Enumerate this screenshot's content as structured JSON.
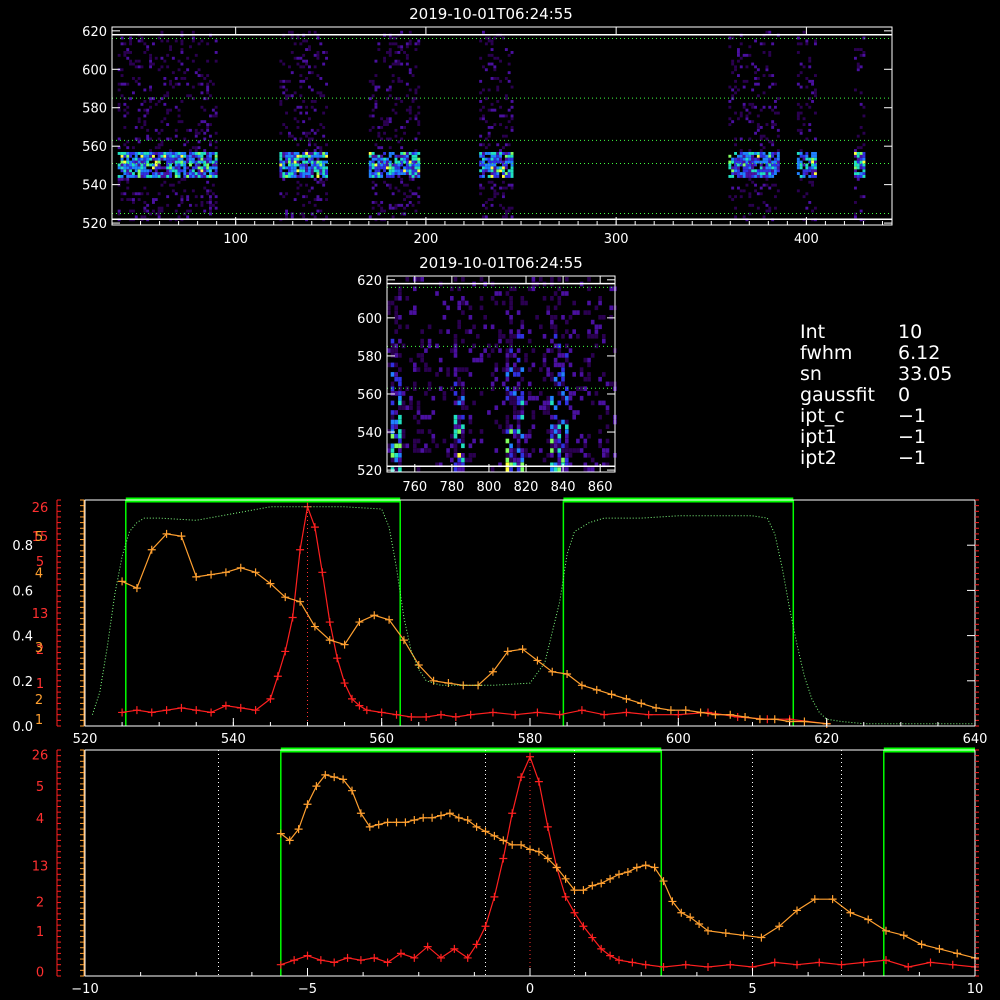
{
  "top_title": "2019-10-01T06:24:55",
  "zoom_title": "2019-10-01T06:24:55",
  "info": [
    {
      "key": "Int",
      "value": "10"
    },
    {
      "key": "fwhm",
      "value": "6.12"
    },
    {
      "key": "sn",
      "value": "33.05"
    },
    {
      "key": "gaussfit",
      "value": "0"
    },
    {
      "key": "ipt_c",
      "value": "−1"
    },
    {
      "key": "ipt1",
      "value": "−1"
    },
    {
      "key": "ipt2",
      "value": "−1"
    }
  ],
  "colors": {
    "background": "#000000",
    "axes": "#ffffff",
    "reference_lines": "#00ff00",
    "cut_line": "#ff3030",
    "profile_red": "#ff2020",
    "profile_orange": "#ffa030",
    "filter_curve": "#80ff80",
    "intensity_high": "#ffff40"
  },
  "chart_data": [
    {
      "type": "heatmap",
      "name": "top-spectrogram",
      "title": "2019-10-01T06:24:55",
      "x_ticks": [
        "100",
        "200",
        "300",
        "400"
      ],
      "y_ticks": [
        "620",
        "600",
        "580",
        "560",
        "540",
        "520"
      ],
      "xlim": [
        35,
        445
      ],
      "ylim": [
        519,
        622
      ],
      "reference_levels": [
        616,
        585,
        563,
        551,
        525
      ],
      "bright_row": 550,
      "bright_row_span": [
        543,
        556
      ],
      "signal_columns": [
        [
          38,
          90
        ],
        [
          123,
          148
        ],
        [
          170,
          196
        ],
        [
          228,
          246
        ],
        [
          359,
          385
        ],
        [
          395,
          405
        ],
        [
          425,
          430
        ]
      ]
    },
    {
      "type": "heatmap",
      "name": "zoom-spectrogram",
      "title": "2019-10-01T06:24:55",
      "x_ticks": [
        "760",
        "780",
        "800",
        "820",
        "840",
        "860"
      ],
      "y_ticks": [
        "620",
        "600",
        "580",
        "560",
        "540",
        "520"
      ],
      "xlim": [
        745,
        868
      ],
      "ylim": [
        519,
        622
      ],
      "reference_levels": [
        616,
        585,
        563
      ],
      "streaks": [
        [
          746,
          752
        ],
        [
          780,
          786
        ],
        [
          808,
          818
        ],
        [
          832,
          842
        ]
      ]
    },
    {
      "type": "line",
      "name": "wavelength-profile",
      "x_ticks": [
        "520",
        "540",
        "560",
        "580",
        "600",
        "620",
        "640"
      ],
      "xlim": [
        520,
        640
      ],
      "ylim": [
        0,
        1
      ],
      "left_ticks_white": [
        "0.0",
        "0.2",
        "0.4",
        "0.6",
        "0.8"
      ],
      "left_ticks_white_values": [
        0.0,
        0.2,
        0.4,
        0.6,
        0.8
      ],
      "left_ticks_red": [
        "26",
        "15",
        "5",
        "13",
        "2",
        "1"
      ],
      "left_ticks_red_values": [
        0.97,
        0.84,
        0.73,
        0.5,
        0.34,
        0.19
      ],
      "left_ticks_orange": [
        "5",
        "4",
        "3",
        "2",
        "1"
      ],
      "left_ticks_orange_values": [
        0.84,
        0.68,
        0.35,
        0.12,
        0.03
      ],
      "green_bands": [
        [
          525.5,
          562.5
        ],
        [
          584.5,
          615.5
        ]
      ],
      "cut_line": 550,
      "series": [
        {
          "color": "red",
          "x": [
            525,
            527,
            529,
            531,
            533,
            535,
            537,
            539,
            541,
            543,
            545,
            546,
            547,
            548,
            549,
            550,
            551,
            552,
            553,
            554,
            555,
            556,
            557,
            558,
            560,
            562,
            564,
            566,
            568,
            570,
            572,
            575,
            578,
            581,
            584,
            587,
            590,
            593,
            596,
            600,
            604,
            608,
            612,
            615,
            620
          ],
          "y": [
            0.06,
            0.07,
            0.06,
            0.07,
            0.08,
            0.07,
            0.06,
            0.09,
            0.08,
            0.07,
            0.12,
            0.22,
            0.33,
            0.48,
            0.78,
            0.97,
            0.88,
            0.68,
            0.46,
            0.3,
            0.19,
            0.12,
            0.09,
            0.07,
            0.06,
            0.05,
            0.04,
            0.04,
            0.05,
            0.04,
            0.05,
            0.06,
            0.05,
            0.06,
            0.05,
            0.07,
            0.05,
            0.06,
            0.05,
            0.05,
            0.06,
            0.04,
            0.03,
            0.03,
            0.01
          ]
        },
        {
          "color": "orange",
          "x": [
            525,
            527,
            529,
            531,
            533,
            535,
            537,
            539,
            541,
            543,
            545,
            547,
            549,
            551,
            553,
            555,
            557,
            559,
            561,
            563,
            565,
            567,
            569,
            571,
            573,
            575,
            577,
            579,
            581,
            583,
            585,
            587,
            589,
            591,
            593,
            595,
            597,
            599,
            601,
            603,
            605,
            607,
            609,
            611,
            613,
            615,
            617,
            620
          ],
          "y": [
            0.64,
            0.61,
            0.78,
            0.85,
            0.84,
            0.66,
            0.67,
            0.68,
            0.7,
            0.68,
            0.63,
            0.57,
            0.55,
            0.44,
            0.38,
            0.36,
            0.46,
            0.49,
            0.47,
            0.38,
            0.27,
            0.2,
            0.19,
            0.18,
            0.18,
            0.24,
            0.33,
            0.34,
            0.29,
            0.24,
            0.23,
            0.18,
            0.16,
            0.14,
            0.12,
            0.1,
            0.08,
            0.07,
            0.07,
            0.06,
            0.05,
            0.05,
            0.04,
            0.03,
            0.03,
            0.02,
            0.02,
            0.01
          ]
        },
        {
          "color": "green-dotted",
          "x": [
            521,
            522,
            523,
            524,
            525,
            526,
            527,
            528,
            530,
            535,
            540,
            545,
            550,
            555,
            560,
            561,
            562,
            563,
            564,
            565,
            566,
            568,
            570,
            575,
            580,
            582,
            584,
            585,
            586,
            588,
            590,
            595,
            600,
            605,
            610,
            612,
            613,
            614,
            615,
            616,
            617,
            618,
            619,
            620,
            622,
            625,
            630,
            635,
            640
          ],
          "y": [
            0.05,
            0.15,
            0.35,
            0.58,
            0.75,
            0.86,
            0.9,
            0.92,
            0.92,
            0.91,
            0.94,
            0.97,
            0.97,
            0.97,
            0.96,
            0.88,
            0.7,
            0.48,
            0.33,
            0.25,
            0.2,
            0.18,
            0.18,
            0.18,
            0.19,
            0.28,
            0.55,
            0.76,
            0.86,
            0.9,
            0.92,
            0.92,
            0.93,
            0.93,
            0.93,
            0.92,
            0.85,
            0.7,
            0.52,
            0.36,
            0.22,
            0.12,
            0.06,
            0.03,
            0.02,
            0.01,
            0.01,
            0.01,
            0.01
          ]
        }
      ]
    },
    {
      "type": "line",
      "name": "velocity-profile",
      "x_ticks": [
        "−10",
        "−5",
        "0",
        "5",
        "10"
      ],
      "xlim": [
        -10,
        10
      ],
      "ylim": [
        0,
        1
      ],
      "left_ticks_red": [
        "26",
        "5",
        "4",
        "13",
        "2",
        "1",
        "0"
      ],
      "left_ticks_red_values": [
        0.98,
        0.84,
        0.7,
        0.49,
        0.33,
        0.2,
        0.02
      ],
      "green_bands": [
        [
          -5.6,
          2.95
        ],
        [
          7.95,
          10
        ]
      ],
      "dotted_lines": [
        -7,
        -1,
        1,
        5,
        7
      ],
      "cut_line": 0,
      "series": [
        {
          "color": "red",
          "x": [
            -5.6,
            -5.3,
            -5.0,
            -4.7,
            -4.4,
            -4.1,
            -3.8,
            -3.5,
            -3.2,
            -2.9,
            -2.6,
            -2.3,
            -2.0,
            -1.7,
            -1.4,
            -1.2,
            -1.0,
            -0.8,
            -0.6,
            -0.4,
            -0.2,
            0.0,
            0.2,
            0.4,
            0.6,
            0.8,
            1.0,
            1.2,
            1.4,
            1.6,
            1.8,
            2.0,
            2.3,
            2.6,
            3.0,
            3.5,
            4.0,
            4.5,
            5.0,
            5.5,
            6.0,
            6.5,
            7.0,
            7.5,
            8.0,
            8.5,
            9.0,
            9.5,
            10.0
          ],
          "y": [
            0.05,
            0.07,
            0.09,
            0.07,
            0.06,
            0.08,
            0.07,
            0.08,
            0.06,
            0.1,
            0.08,
            0.13,
            0.08,
            0.12,
            0.08,
            0.14,
            0.22,
            0.35,
            0.52,
            0.72,
            0.88,
            0.97,
            0.86,
            0.66,
            0.48,
            0.35,
            0.28,
            0.22,
            0.17,
            0.12,
            0.09,
            0.07,
            0.06,
            0.05,
            0.04,
            0.05,
            0.04,
            0.05,
            0.04,
            0.06,
            0.05,
            0.06,
            0.05,
            0.06,
            0.07,
            0.04,
            0.06,
            0.05,
            0.04
          ]
        },
        {
          "color": "orange",
          "x": [
            -5.6,
            -5.4,
            -5.2,
            -5.0,
            -4.8,
            -4.6,
            -4.4,
            -4.2,
            -4.0,
            -3.8,
            -3.6,
            -3.4,
            -3.2,
            -3.0,
            -2.8,
            -2.6,
            -2.4,
            -2.2,
            -2.0,
            -1.8,
            -1.6,
            -1.4,
            -1.2,
            -1.0,
            -0.8,
            -0.6,
            -0.4,
            -0.2,
            0.0,
            0.2,
            0.4,
            0.6,
            0.8,
            1.0,
            1.2,
            1.4,
            1.6,
            1.8,
            2.0,
            2.2,
            2.4,
            2.6,
            2.8,
            3.0,
            3.2,
            3.4,
            3.6,
            3.8,
            4.0,
            4.4,
            4.8,
            5.2,
            5.6,
            6.0,
            6.4,
            6.8,
            7.2,
            7.6,
            8.0,
            8.4,
            8.8,
            9.2,
            9.6,
            10.0
          ],
          "y": [
            0.63,
            0.6,
            0.65,
            0.76,
            0.84,
            0.89,
            0.88,
            0.87,
            0.82,
            0.72,
            0.66,
            0.67,
            0.68,
            0.68,
            0.68,
            0.69,
            0.7,
            0.7,
            0.71,
            0.72,
            0.7,
            0.69,
            0.66,
            0.64,
            0.62,
            0.6,
            0.58,
            0.58,
            0.56,
            0.55,
            0.52,
            0.48,
            0.43,
            0.38,
            0.38,
            0.4,
            0.41,
            0.43,
            0.45,
            0.46,
            0.48,
            0.49,
            0.48,
            0.42,
            0.33,
            0.28,
            0.26,
            0.23,
            0.2,
            0.19,
            0.18,
            0.17,
            0.22,
            0.29,
            0.34,
            0.34,
            0.28,
            0.25,
            0.2,
            0.18,
            0.14,
            0.12,
            0.1,
            0.08
          ]
        }
      ]
    }
  ]
}
